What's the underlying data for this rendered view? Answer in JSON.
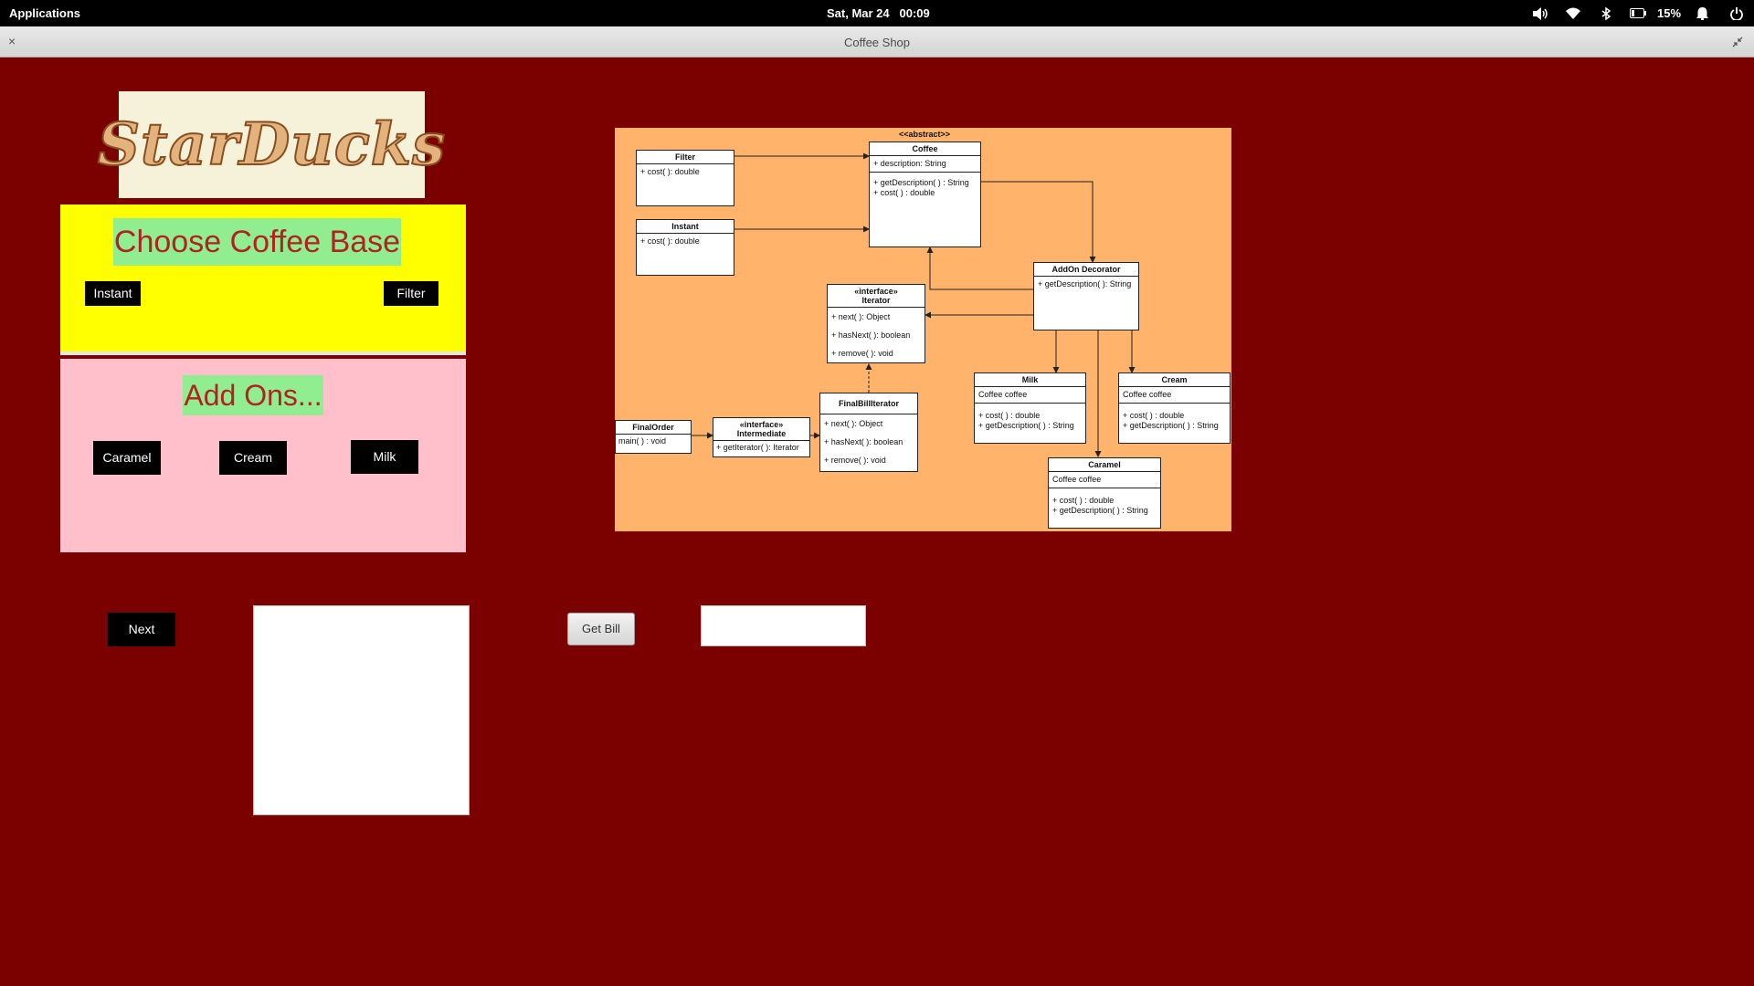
{
  "topbar": {
    "applications": "Applications",
    "date": "Sat, Mar 24",
    "time": "00:09",
    "battery": "15%",
    "icons": [
      "volume-icon",
      "wifi-icon",
      "bluetooth-icon",
      "battery-icon",
      "bell-icon",
      "power-icon"
    ]
  },
  "window": {
    "title": "Coffee Shop",
    "close": "×"
  },
  "logo": {
    "text": "StarDucks"
  },
  "base_panel": {
    "heading": "Choose Coffee Base",
    "buttons": {
      "instant": "Instant",
      "filter": "Filter"
    },
    "background": "#ffff00"
  },
  "addon_panel": {
    "heading": "Add Ons...",
    "buttons": {
      "caramel": "Caramel",
      "cream": "Cream",
      "milk": "Milk"
    },
    "background": "#ffc0cb"
  },
  "controls": {
    "next": "Next",
    "get_bill": "Get Bill",
    "order_text": "",
    "bill_value": ""
  },
  "uml": {
    "background": "#ffb36b",
    "abstract_stereo": "<<abstract>>",
    "classes": {
      "filter": {
        "name": "Filter",
        "methods": [
          "+ cost( ): double"
        ]
      },
      "instant": {
        "name": "Instant",
        "methods": [
          "+ cost( ): double"
        ]
      },
      "coffee": {
        "name": "Coffee",
        "attrs": [
          "+ description: String"
        ],
        "methods": [
          "+ getDescription( ) : String",
          "+ cost( ) : double"
        ]
      },
      "addon": {
        "name": "AddOn Decorator",
        "methods": [
          "+ getDescription( ): String"
        ]
      },
      "iterator": {
        "stereo": "«interface»",
        "name": "Iterator",
        "methods": [
          "+ next( ): Object",
          "+ hasNext( ): boolean",
          "+ remove( ): void"
        ]
      },
      "milk": {
        "name": "Milk",
        "attrs": [
          "Coffee coffee"
        ],
        "methods": [
          "+ cost( ) : double",
          "+ getDescription( ) : String"
        ]
      },
      "cream": {
        "name": "Cream",
        "attrs": [
          "Coffee coffee"
        ],
        "methods": [
          "+ cost( ) : double",
          "+ getDescription( ) : String"
        ]
      },
      "caramel": {
        "name": "Caramel",
        "attrs": [
          "Coffee coffee"
        ],
        "methods": [
          "+ cost( ) : double",
          "+ getDescription( ) : String"
        ]
      },
      "finalorder": {
        "name": "FinalOrder",
        "methods": [
          "main( ) : void"
        ]
      },
      "intermediate": {
        "stereo": "«interface»",
        "name": "Intermediate",
        "methods": [
          "+ getIterator( ): Iterator"
        ]
      },
      "finalbill": {
        "name": "FinalBillIterator",
        "methods": [
          "+ next( ): Object",
          "+ hasNext( ): boolean",
          "+ remove( ): void"
        ]
      }
    }
  }
}
